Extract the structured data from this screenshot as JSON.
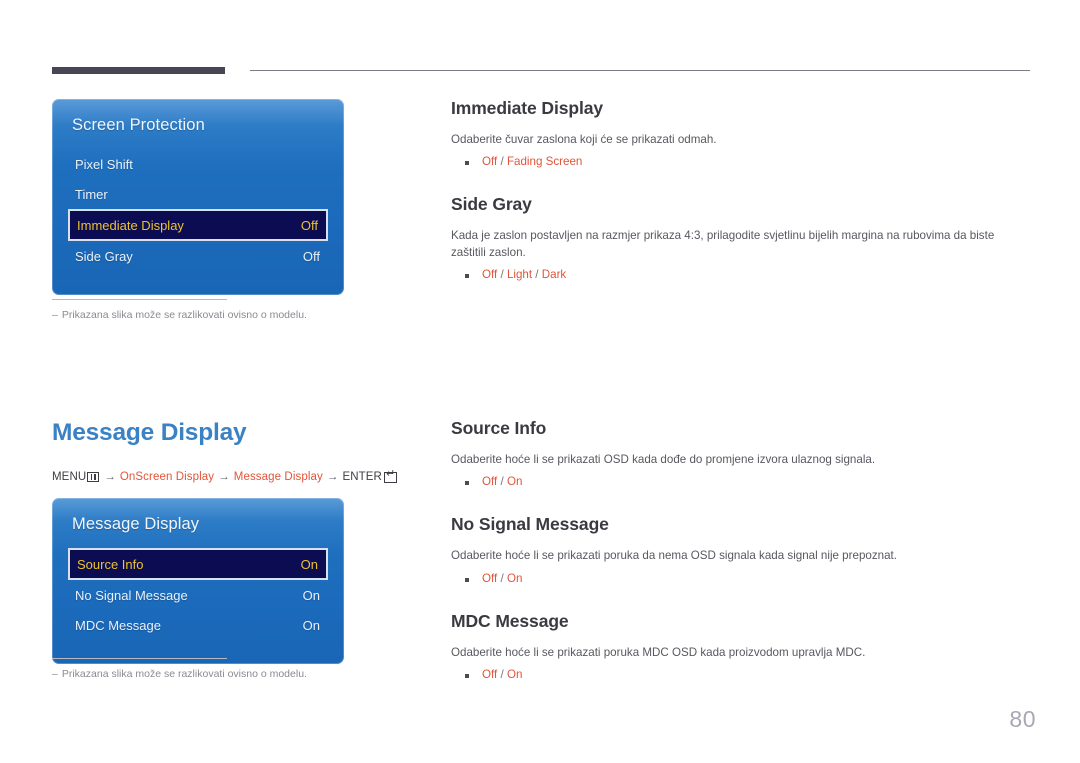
{
  "page_number": "80",
  "header": {
    "bar_color": "#484654",
    "line_color": "#7b7b85"
  },
  "accent_colors": {
    "option_orange": "#e2543a",
    "section_blue": "#3b82c4",
    "osd_highlight_bg": "#0c0c52",
    "osd_highlight_text": "#ecc22c"
  },
  "panels": [
    {
      "title": "Screen Protection",
      "rows": [
        {
          "label": "Pixel Shift",
          "value": "",
          "selected": false
        },
        {
          "label": "Timer",
          "value": "",
          "selected": false
        },
        {
          "label": "Immediate Display",
          "value": "Off",
          "selected": true
        },
        {
          "label": "Side Gray",
          "value": "Off",
          "selected": false
        }
      ],
      "note": {
        "dash": "–",
        "text": "Prikazana slika može se razlikovati ovisno o modelu."
      }
    },
    {
      "title": "Message Display",
      "rows": [
        {
          "label": "Source Info",
          "value": "On",
          "selected": true
        },
        {
          "label": "No Signal Message",
          "value": "On",
          "selected": false
        },
        {
          "label": "MDC Message",
          "value": "On",
          "selected": false
        }
      ],
      "note": {
        "dash": "–",
        "text": "Prikazana slika može se razlikovati ovisno o modelu."
      }
    }
  ],
  "section": {
    "title": "Message Display",
    "breadcrumb": {
      "menu_label": "MENU",
      "menu_icon": "menu-grid-icon",
      "arrow": "→",
      "step_1": "OnScreen Display",
      "step_2": "Message Display",
      "enter_label": "ENTER",
      "enter_icon": "enter-key-icon"
    }
  },
  "blocks_top": [
    {
      "heading": "Immediate Display",
      "body": "Odaberite čuvar zaslona koji će se prikazati odmah.",
      "options": [
        {
          "text": "Off",
          "kind": "opt"
        },
        {
          "text": " / ",
          "kind": "sep"
        },
        {
          "text": "Fading Screen",
          "kind": "opt"
        }
      ]
    },
    {
      "heading": "Side Gray",
      "body": "Kada je zaslon postavljen na razmjer prikaza 4:3, prilagodite svjetlinu bijelih margina na rubovima da biste zaštitili zaslon.",
      "options": [
        {
          "text": "Off",
          "kind": "opt"
        },
        {
          "text": " / ",
          "kind": "sep"
        },
        {
          "text": "Light",
          "kind": "opt"
        },
        {
          "text": " / ",
          "kind": "sep"
        },
        {
          "text": "Dark",
          "kind": "opt"
        }
      ]
    }
  ],
  "blocks_bottom": [
    {
      "heading": "Source Info",
      "body": "Odaberite hoće li se prikazati OSD kada dođe do promjene izvora ulaznog signala.",
      "options": [
        {
          "text": "Off",
          "kind": "opt"
        },
        {
          "text": " / ",
          "kind": "sep"
        },
        {
          "text": "On",
          "kind": "opt"
        }
      ]
    },
    {
      "heading": "No Signal Message",
      "body": "Odaberite hoće li se prikazati poruka da nema OSD signala kada signal nije prepoznat.",
      "options": [
        {
          "text": "Off",
          "kind": "opt"
        },
        {
          "text": " / ",
          "kind": "sep"
        },
        {
          "text": "On",
          "kind": "opt"
        }
      ]
    },
    {
      "heading": "MDC Message",
      "body": "Odaberite hoće li se prikazati poruka MDC OSD kada proizvodom upravlja MDC.",
      "options": [
        {
          "text": "Off",
          "kind": "opt"
        },
        {
          "text": " / ",
          "kind": "sep"
        },
        {
          "text": "On",
          "kind": "opt"
        }
      ]
    }
  ]
}
